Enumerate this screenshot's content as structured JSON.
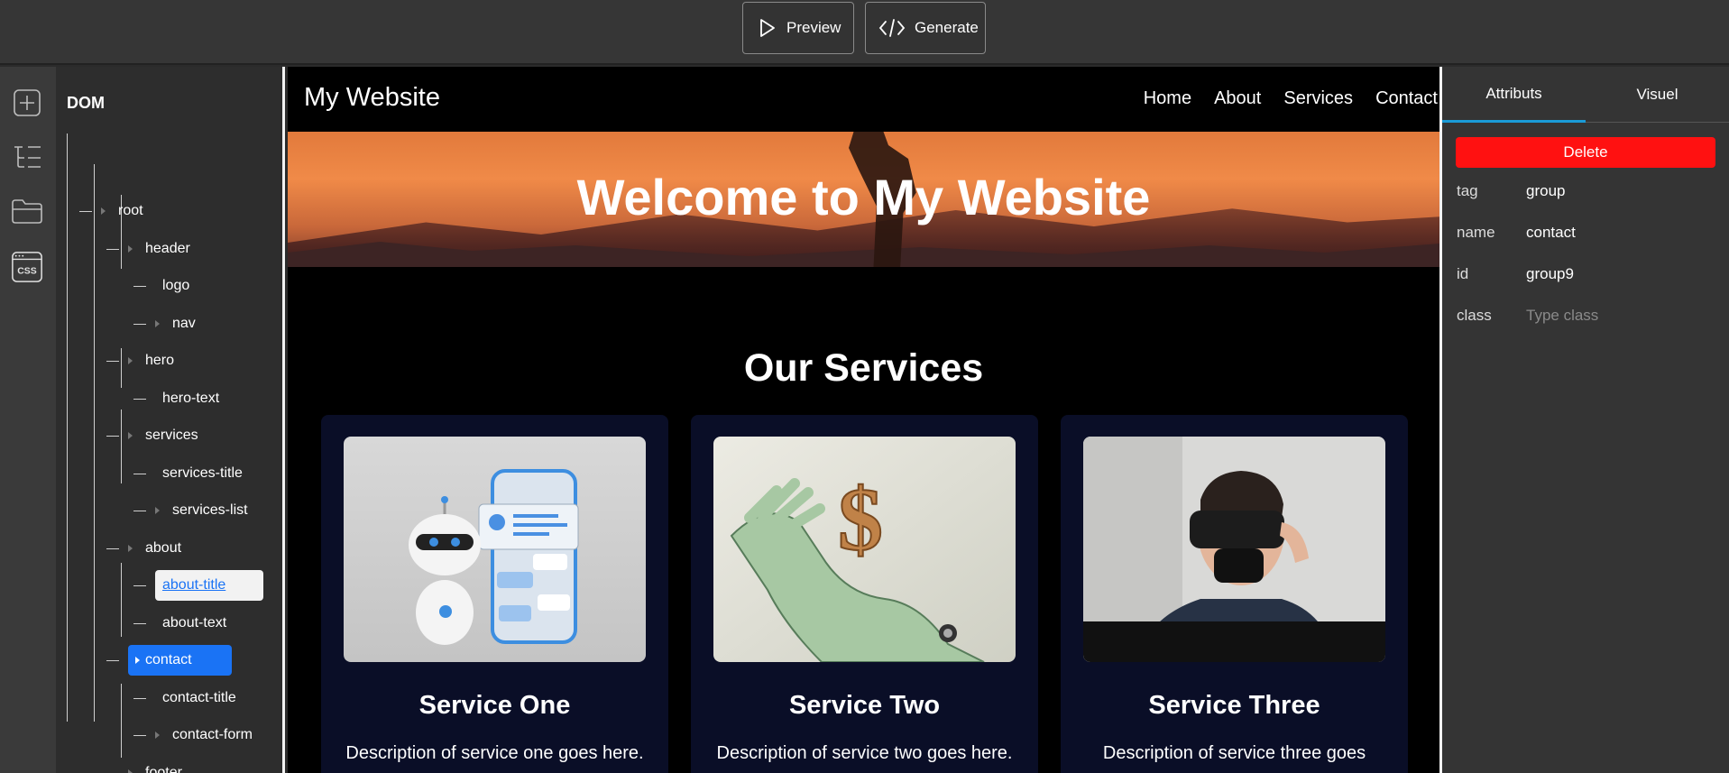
{
  "toolbar": {
    "preview_label": "Preview",
    "generate_label": "Generate"
  },
  "rail": {
    "icons": [
      "add-icon",
      "tree-icon",
      "folder-icon",
      "css-icon"
    ],
    "css_label": "CSS"
  },
  "dom": {
    "title": "DOM",
    "items": [
      {
        "label": "root"
      },
      {
        "label": "header"
      },
      {
        "label": "logo"
      },
      {
        "label": "nav"
      },
      {
        "label": "hero"
      },
      {
        "label": "hero-text"
      },
      {
        "label": "services"
      },
      {
        "label": "services-title"
      },
      {
        "label": "services-list"
      },
      {
        "label": "about"
      },
      {
        "label": "about-title"
      },
      {
        "label": "about-text"
      },
      {
        "label": "contact"
      },
      {
        "label": "contact-title"
      },
      {
        "label": "contact-form"
      },
      {
        "label": "footer"
      }
    ],
    "selected": "contact",
    "editing": "about-title"
  },
  "site": {
    "logo": "My Website",
    "nav": [
      "Home",
      "About",
      "Services",
      "Contact"
    ],
    "hero_text": "Welcome to My Website",
    "services_title": "Our Services",
    "cards": [
      {
        "title": "Service One",
        "description": "Description of service one goes here.",
        "image": "robot-chat-image"
      },
      {
        "title": "Service Two",
        "description": "Description of service two goes here.",
        "image": "robot-hand-dollar-image"
      },
      {
        "title": "Service Three",
        "description": "Description of service three goes",
        "image": "vr-headset-image"
      }
    ]
  },
  "attributes": {
    "tabs": [
      "Attributs",
      "Visuel"
    ],
    "active_tab": "Attributs",
    "delete_label": "Delete",
    "rows": [
      {
        "key": "tag",
        "value": "group"
      },
      {
        "key": "name",
        "value": "contact"
      },
      {
        "key": "id",
        "value": "group9"
      },
      {
        "key": "class",
        "value": "",
        "placeholder": "Type class"
      }
    ]
  },
  "colors": {
    "accent_blue": "#1a73f5",
    "delete_red": "#ff1111",
    "card_bg": "#0a0e27",
    "tab_underline": "#1a9bd7"
  }
}
